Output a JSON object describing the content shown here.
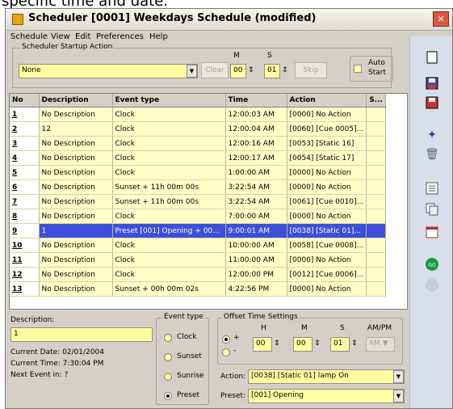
{
  "caption": "specific time and date.",
  "window": {
    "title": "Scheduler [0001] Weekdays Schedule (modified)",
    "close": "✕"
  },
  "menu": [
    "Schedule",
    "View",
    "Edit",
    "Preferences",
    "Help"
  ],
  "startup": {
    "legend": "Scheduler Startup Action",
    "action_value": "None",
    "clear_label": "Clear",
    "skip_label": "Skip",
    "m_label": "M",
    "s_label": "S",
    "m_value": "00",
    "s_value": "01",
    "auto_start_label_1": "Auto",
    "auto_start_label_2": "Start"
  },
  "table": {
    "columns": [
      "No",
      "Description",
      "Event type",
      "Time",
      "Action",
      "S..."
    ],
    "rows": [
      {
        "no": "1",
        "description": "No Description",
        "event_type": "Clock",
        "time": "12:00:03 AM",
        "action": "[0000] No Action",
        "s": ""
      },
      {
        "no": "2",
        "description": "12",
        "event_type": "Clock",
        "time": "12:00:04 AM",
        "action": "[0060] [Cue 0005]...",
        "s": ""
      },
      {
        "no": "3",
        "description": "No Description",
        "event_type": "Clock",
        "time": "12:00:16 AM",
        "action": "[0053] [Static 16]",
        "s": ""
      },
      {
        "no": "4",
        "description": "No Description",
        "event_type": "Clock",
        "time": "12:00:17 AM",
        "action": "[0054] [Static 17]",
        "s": ""
      },
      {
        "no": "5",
        "description": "No Description",
        "event_type": "Clock",
        "time": "1:00:00 AM",
        "action": "[0000] No Action",
        "s": ""
      },
      {
        "no": "6",
        "description": "No Description",
        "event_type": "Sunset + 11h 00m 00s",
        "time": "3:22:54 AM",
        "action": "[0000] No Action",
        "s": ""
      },
      {
        "no": "7",
        "description": "No Description",
        "event_type": "Sunset + 11h 00m 00s",
        "time": "3:22:54 AM",
        "action": "[0061] [Cue 0010]...",
        "s": ""
      },
      {
        "no": "8",
        "description": "No Description",
        "event_type": "Clock",
        "time": "7:00:00 AM",
        "action": "[0000] No Action",
        "s": ""
      },
      {
        "no": "9",
        "description": "1",
        "event_type": "Preset [001] Opening + 00...",
        "time": "9:00:01 AM",
        "action": "[0038] [Static 01]...",
        "s": ""
      },
      {
        "no": "10",
        "description": "No Description",
        "event_type": "Clock",
        "time": "10:00:00 AM",
        "action": "[0058] [Cue 0008]...",
        "s": ""
      },
      {
        "no": "11",
        "description": "No Description",
        "event_type": "Clock",
        "time": "11:00:00 AM",
        "action": "[0000] No Action",
        "s": ""
      },
      {
        "no": "12",
        "description": "No Description",
        "event_type": "Clock",
        "time": "12:00:00 PM",
        "action": "[0012] [Cue 0006]...",
        "s": ""
      },
      {
        "no": "13",
        "description": "No Description",
        "event_type": "Sunset + 00h 00m 02s",
        "time": "4:22:56 PM",
        "action": "[0000] No Action",
        "s": ""
      }
    ]
  },
  "details": {
    "description_label": "Description:",
    "description_value": "1",
    "current_date": "Current Date: 02/01/2004",
    "current_time": "Current Time: 7:30:04 PM",
    "next_event": "Next Event in: ?"
  },
  "event_type": {
    "legend": "Event type",
    "options": [
      "Clock",
      "Sunset",
      "Sunrise",
      "Preset"
    ],
    "selected": "Preset"
  },
  "offset": {
    "legend": "Offset Time Settings",
    "plus": "+",
    "minus": "-",
    "h_label": "H",
    "m_label": "M",
    "s_label": "S",
    "ampm_label": "AM/PM",
    "h_value": "00",
    "m_value": "00",
    "s_value": "01",
    "ampm_value": "AM"
  },
  "action": {
    "label": "Action:",
    "value": "[0038] [Static 01] lamp On"
  },
  "preset": {
    "label": "Preset:",
    "value": "[001] Opening"
  },
  "colors": {
    "selected_row": "#3d4fd8",
    "field_yellow": "#ffff9f",
    "toolbar_bg": "#d8dfea"
  },
  "toolbar_icons": [
    "new-icon",
    "save-icon",
    "save-as-icon",
    "add-icon",
    "delete-icon",
    "properties-icon",
    "copy-icon",
    "calendar-icon",
    "run-icon",
    "stop-icon"
  ]
}
